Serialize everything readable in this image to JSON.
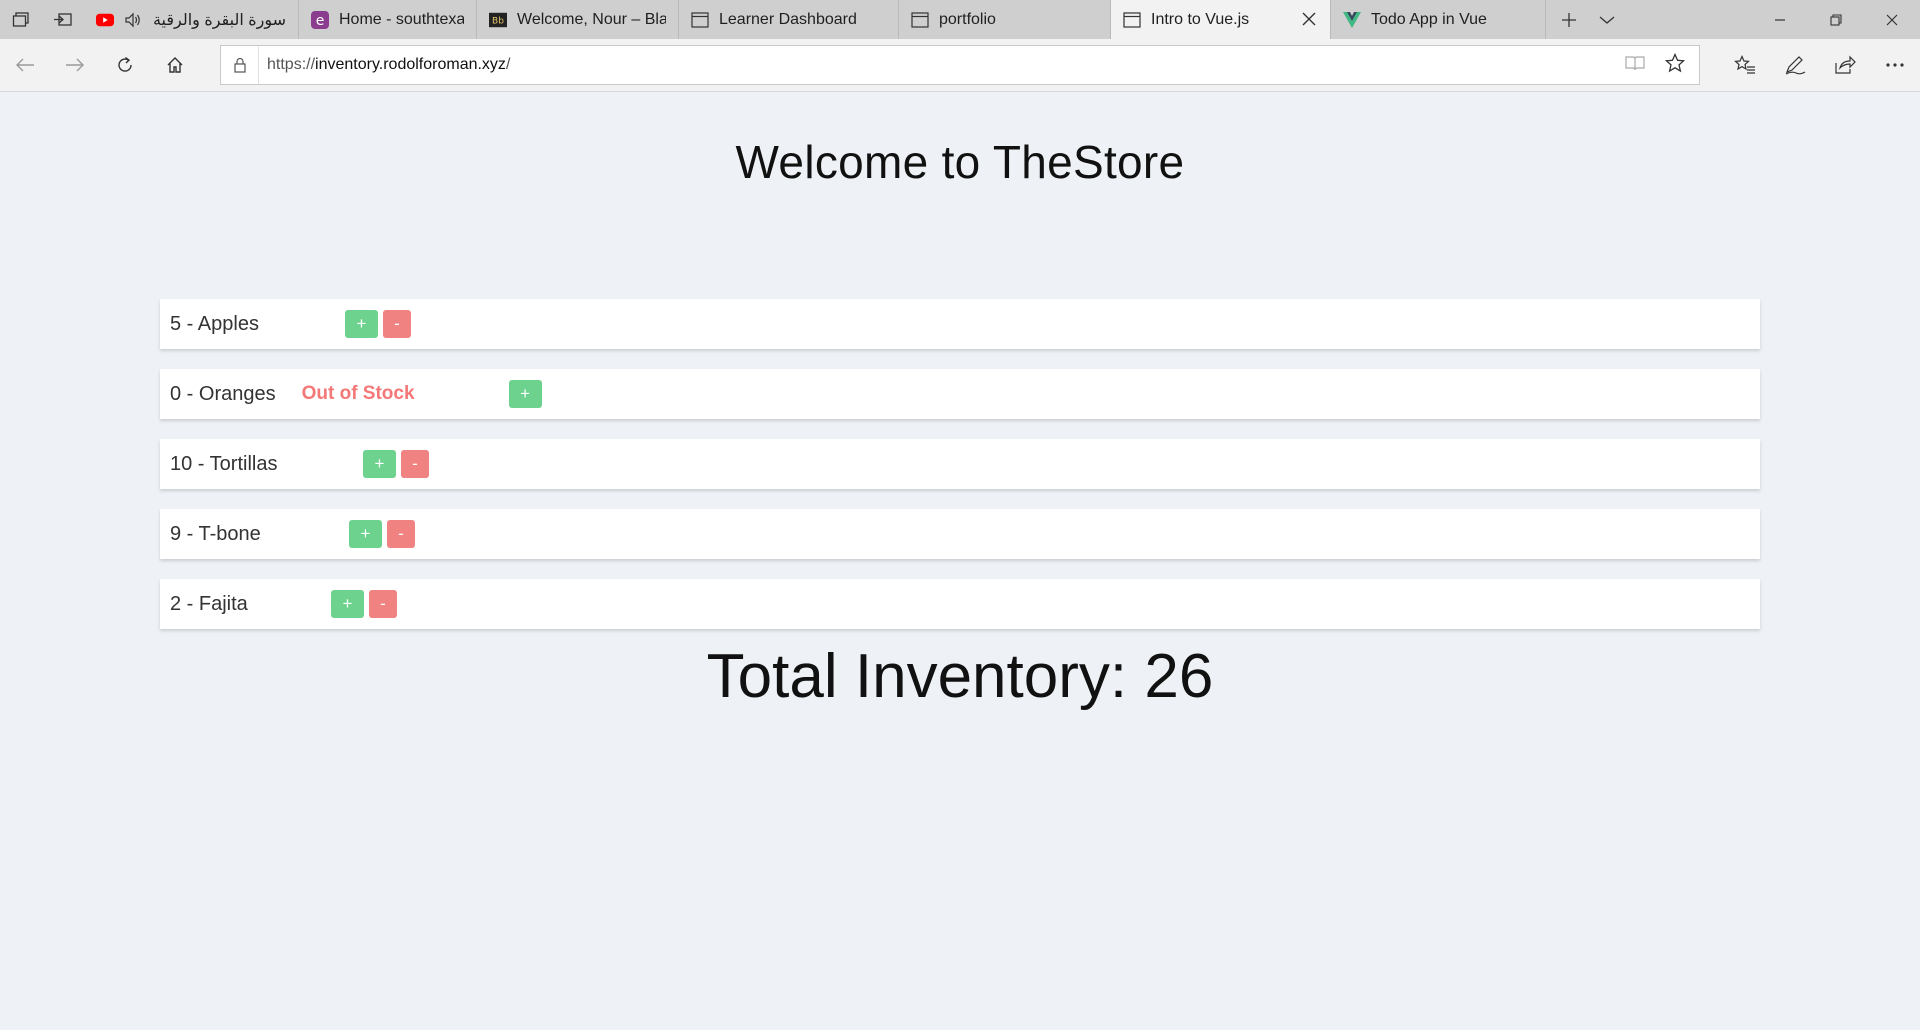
{
  "browser": {
    "tabs": [
      {
        "title": "سورة البقرة والرقية ا",
        "favicon": "youtube-icon",
        "audio": true
      },
      {
        "title": "Home - southtexascolle",
        "favicon": "e-logo-icon"
      },
      {
        "title": "Welcome, Nour – Black",
        "favicon": "blackboard-icon"
      },
      {
        "title": "Learner Dashboard",
        "favicon": "page-icon"
      },
      {
        "title": "portfolio",
        "favicon": "page-icon"
      },
      {
        "title": "Intro to Vue.js",
        "favicon": "page-icon",
        "active": true
      },
      {
        "title": "Todo App in Vue",
        "favicon": "vue-icon"
      }
    ],
    "url_prefix": "https://",
    "url_host": "inventory.rodolforoman.xyz",
    "url_suffix": "/"
  },
  "page": {
    "heading": "Welcome to TheStore",
    "items": [
      {
        "text": "5 - Apples",
        "plus": "+",
        "minus": "-"
      },
      {
        "text": "0 - Oranges",
        "status": "Out of Stock",
        "plus": "+"
      },
      {
        "text": "10 - Tortillas",
        "plus": "+",
        "minus": "-"
      },
      {
        "text": "9 - T-bone",
        "plus": "+",
        "minus": "-"
      },
      {
        "text": "2 - Fajita",
        "plus": "+",
        "minus": "-"
      }
    ],
    "total": "Total Inventory: 26"
  },
  "colors": {
    "plus": "#6dd28e",
    "minus": "#f08282",
    "out_of_stock": "#f47878",
    "page_bg": "#eef2f6"
  }
}
